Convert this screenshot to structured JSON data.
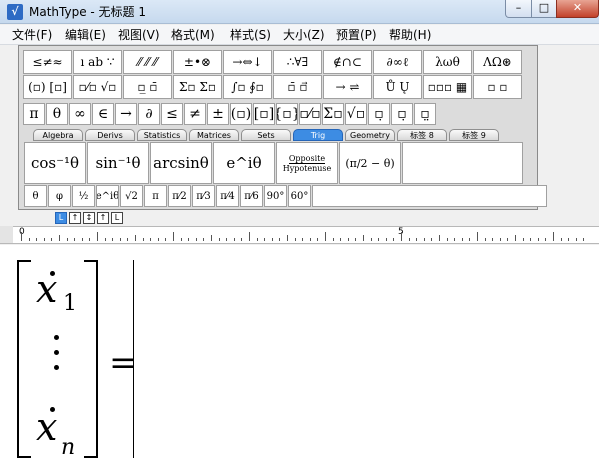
{
  "window": {
    "title": "MathType - 无标题 1",
    "min": "–",
    "max": "□",
    "close": "✕"
  },
  "menu": [
    "文件(F)",
    "编辑(E)",
    "视图(V)",
    "格式(M)",
    "样式(S)",
    "大小(Z)",
    "预置(P)",
    "帮助(H)"
  ],
  "toolbar": {
    "row1": [
      "≤≠≈",
      "ı ab ∵",
      "⁄⁄ ⁄⁄ ⁄⁄",
      "±•⊗",
      "→⇔↓",
      "∴∀∃",
      "∉∩⊂",
      "∂∞ℓ",
      "λωθ",
      "ΛΩ⊛"
    ],
    "row2": [
      "(▫) [▫]",
      "▫⁄▫ √▫",
      "▫̲ ▫̄",
      "Σ▫ Σ▫",
      "∫▫ ∮▫",
      "▫̄ ▫⃗",
      "→ ⇌",
      "Ů Ų",
      "▫▫▫ ▦",
      "▫ ▫"
    ],
    "row3": [
      "π",
      "θ",
      "∞",
      "∈",
      "→",
      "∂",
      "≤",
      "≠",
      "±",
      "(▫)",
      "[▫]",
      "{▫}",
      "▫⁄▫",
      "Σ▫",
      "√▫",
      "▫̣",
      "▫̣",
      "▫̤"
    ],
    "tabs": [
      "Algebra",
      "Derivs",
      "Statistics",
      "Matrices",
      "Sets",
      "Trig",
      "Geometry",
      "标签 8",
      "标签 9"
    ],
    "active_tab": "Trig",
    "row4": [
      "cos⁻¹θ",
      "sin⁻¹θ",
      "arcsinθ",
      "e^iθ",
      "Opposite",
      "Hypotenuse",
      "(π/2 − θ)"
    ],
    "row5": [
      "θ",
      "φ",
      "½",
      "e^iθ",
      "√2",
      "π",
      "π⁄2",
      "π⁄3",
      "π⁄4",
      "π⁄6",
      "90°",
      "60°"
    ]
  },
  "ruler": {
    "controls": [
      "L",
      "↑",
      "↕",
      "↑",
      "L"
    ],
    "marks": [
      "0",
      "5"
    ]
  },
  "equation": {
    "x": "x",
    "sub1": "1",
    "subn": "n",
    "vdots": "⋮",
    "equals": "="
  }
}
